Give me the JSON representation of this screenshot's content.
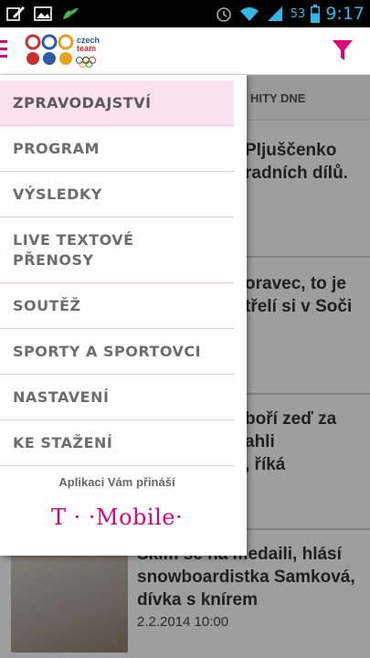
{
  "status_bar": {
    "battery_level": "53",
    "time": "9:17"
  },
  "header": {
    "logo_text": [
      "czech",
      "team"
    ]
  },
  "tabs": {
    "hity": "HITY DNE"
  },
  "articles": [
    {
      "title": "Pljuščenko\nradních dílů."
    },
    {
      "title": "oravec, to je\ntřelí si v Soči"
    },
    {
      "title": "boří zeď za\nahli\n, říká"
    },
    {
      "title": "Skim se na medaili, hlásí\nsnowboardistka Samková,\ndívka s knírem",
      "date": "2.2.2014 10:00"
    }
  ],
  "drawer": {
    "items": [
      {
        "label": "ZPRAVODAJSTVÍ"
      },
      {
        "label": "PROGRAM"
      },
      {
        "label": "VÝSLEDKY"
      },
      {
        "label": "LIVE TEXTOVÉ\nPŘENOSY"
      },
      {
        "label": "SOUTĚŽ"
      },
      {
        "label": "SPORTY A SPORTOVCI"
      },
      {
        "label": "NASTAVENÍ"
      },
      {
        "label": "KE STAŽENÍ"
      }
    ],
    "promo_text": "Aplikaci Vám přináší",
    "sponsor": "T · ·Mobile·"
  },
  "colors": {
    "accent": "#e2007a",
    "active_bg": "#fbe1ef",
    "status_blue": "#31b6e7"
  }
}
